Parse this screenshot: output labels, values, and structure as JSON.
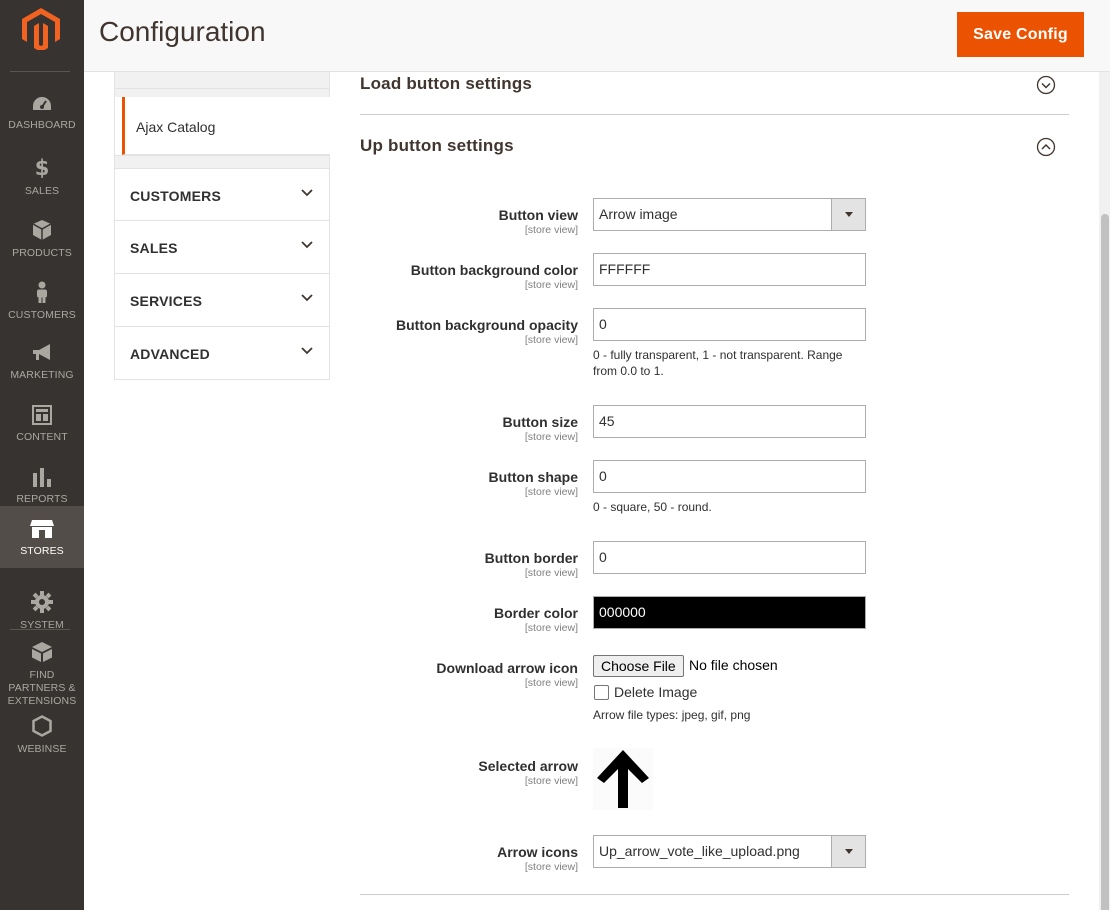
{
  "header": {
    "title": "Configuration",
    "save_label": "Save Config"
  },
  "menu": {
    "items": [
      {
        "label": "DASHBOARD",
        "icon": "dashboard-icon"
      },
      {
        "label": "SALES",
        "icon": "dollar-icon"
      },
      {
        "label": "PRODUCTS",
        "icon": "box-icon"
      },
      {
        "label": "CUSTOMERS",
        "icon": "person-icon"
      },
      {
        "label": "MARKETING",
        "icon": "megaphone-icon"
      },
      {
        "label": "CONTENT",
        "icon": "layout-icon"
      },
      {
        "label": "REPORTS",
        "icon": "bar-chart-icon"
      },
      {
        "label": "STORES",
        "icon": "store-icon"
      },
      {
        "label": "SYSTEM",
        "icon": "gear-icon"
      },
      {
        "label": "FIND PARTNERS & EXTENSIONS",
        "icon": "blocks-icon"
      },
      {
        "label": "WEBINSE",
        "icon": "hexagon-icon"
      }
    ],
    "active": "STORES"
  },
  "tabs": {
    "sub_item": "Ajax Catalog",
    "groups": [
      "CUSTOMERS",
      "SALES",
      "SERVICES",
      "ADVANCED"
    ]
  },
  "sections": {
    "load": "Load button settings",
    "up": "Up button settings"
  },
  "fields": {
    "scope": "[store view]",
    "button_view": {
      "label": "Button view",
      "value": "Arrow image"
    },
    "bg_color": {
      "label": "Button background color",
      "value": "FFFFFF"
    },
    "bg_opacity": {
      "label": "Button background opacity",
      "value": "0",
      "note": "0 - fully transparent, 1 - not transparent. Range from 0.0 to 1."
    },
    "size": {
      "label": "Button size",
      "value": "45"
    },
    "shape": {
      "label": "Button shape",
      "value": "0",
      "note": "0 - square, 50 - round."
    },
    "border": {
      "label": "Button border",
      "value": "0"
    },
    "border_color": {
      "label": "Border color",
      "value": "000000"
    },
    "download": {
      "label": "Download arrow icon",
      "button": "Choose File",
      "status": "No file chosen",
      "delete_label": "Delete Image",
      "note": "Arrow file types: jpeg, gif, png"
    },
    "selected": {
      "label": "Selected arrow"
    },
    "arrow_icons": {
      "label": "Arrow icons",
      "value": "Up_arrow_vote_like_upload.png"
    }
  },
  "colors": {
    "accent": "#eb5202",
    "menu_bg": "#373330",
    "menu_active": "#524d49"
  }
}
